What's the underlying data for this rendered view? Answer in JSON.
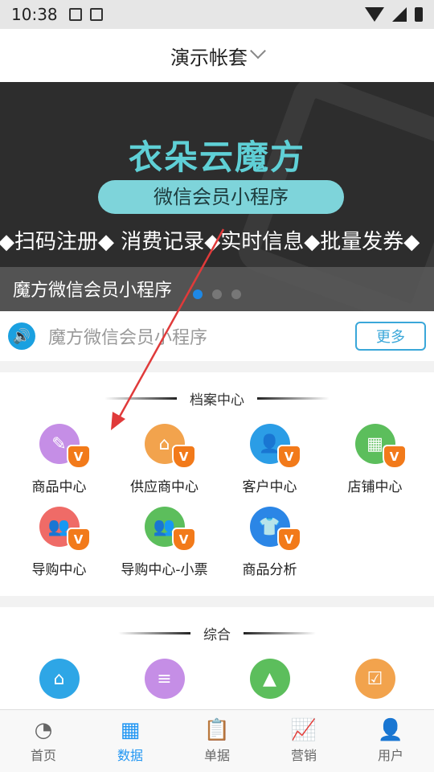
{
  "status_bar": {
    "time": "10:38"
  },
  "header": {
    "title": "演示帐套"
  },
  "banner": {
    "brand": "衣朵云魔方",
    "pill": "微信会员小程序",
    "features": "◆扫码注册◆ 消费记录◆实时信息◆批量发券◆",
    "caption": "魔方微信会员小程序"
  },
  "notice": {
    "text": "魔方微信会员小程序",
    "more_label": "更多"
  },
  "archive_section": {
    "title": "档案中心",
    "items": [
      {
        "label": "商品中心",
        "color": "#c58ee6",
        "icon": "tag-icon"
      },
      {
        "label": "供应商中心",
        "color": "#f2a34d",
        "icon": "house-icon"
      },
      {
        "label": "客户中心",
        "color": "#2b9de6",
        "icon": "user-search-icon"
      },
      {
        "label": "店铺中心",
        "color": "#5cbe5c",
        "icon": "store-icon"
      },
      {
        "label": "导购中心",
        "color": "#ef6b67",
        "icon": "users-icon"
      },
      {
        "label": "导购中心-小票",
        "color": "#5cbe5c",
        "icon": "users-icon"
      },
      {
        "label": "商品分析",
        "color": "#2b86e6",
        "icon": "shirt-icon"
      }
    ],
    "badge_text": "V"
  },
  "general_section": {
    "title": "综合",
    "items": [
      {
        "color": "#2ea6e6",
        "icon": "home-search-icon"
      },
      {
        "color": "#c58ee6",
        "icon": "document-icon"
      },
      {
        "color": "#5cbe5c",
        "icon": "image-icon"
      },
      {
        "color": "#f2a34d",
        "icon": "checklist-icon"
      }
    ]
  },
  "tabbar": {
    "items": [
      {
        "label": "首页",
        "icon": "dashboard-icon",
        "active": false
      },
      {
        "label": "数据",
        "icon": "grid-icon",
        "active": true
      },
      {
        "label": "单据",
        "icon": "clipboard-icon",
        "active": false
      },
      {
        "label": "营销",
        "icon": "chart-monitor-icon",
        "active": false
      },
      {
        "label": "用户",
        "icon": "user-icon",
        "active": false
      }
    ]
  },
  "colors": {
    "accent": "#2196f3",
    "annotation_arrow": "#e03a3a"
  }
}
